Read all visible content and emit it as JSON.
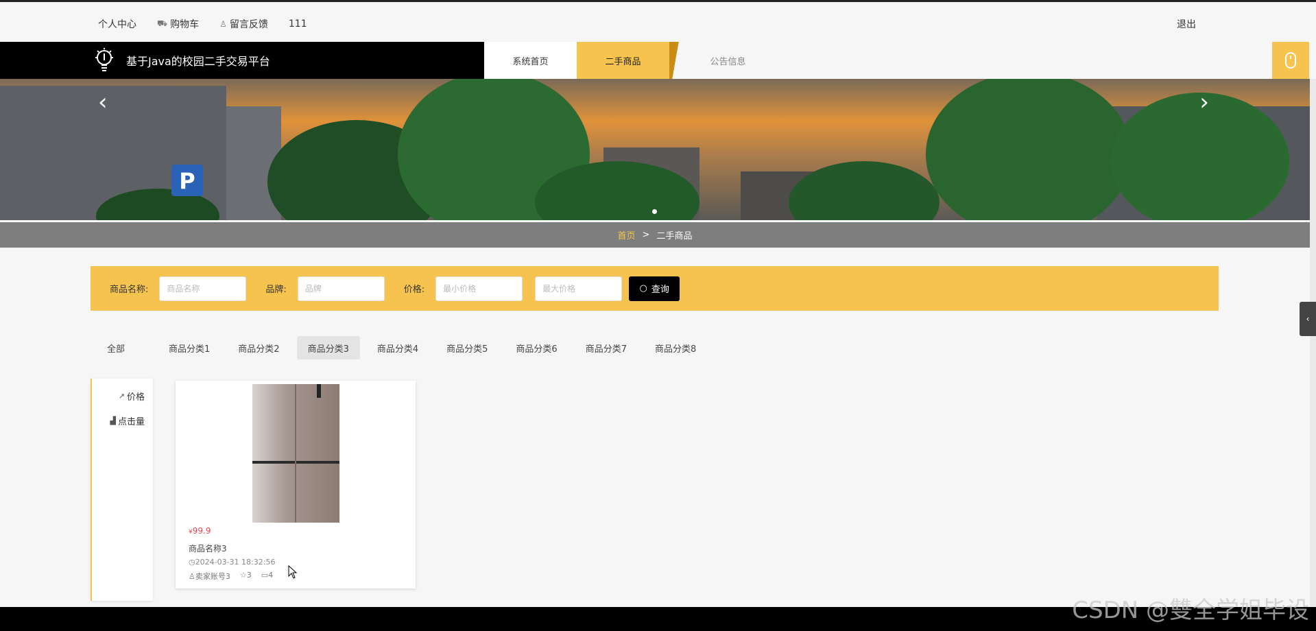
{
  "topbar": {
    "personal_center": "个人中心",
    "cart": "购物车",
    "feedback": "留言反馈",
    "username": "111",
    "logout": "退出"
  },
  "navbar": {
    "site_title": "基于Java的校园二手交易平台",
    "items": [
      {
        "label": "系统首页",
        "active": false
      },
      {
        "label": "二手商品",
        "active": true
      },
      {
        "label": "公告信息",
        "active": false
      }
    ]
  },
  "breadcrumb": {
    "home": "首页",
    "separator": ">",
    "current": "二手商品"
  },
  "search": {
    "name_label": "商品名称:",
    "name_placeholder": "商品名称",
    "brand_label": "品牌:",
    "brand_placeholder": "品牌",
    "price_label": "价格:",
    "min_price_placeholder": "最小价格",
    "max_price_placeholder": "最大价格",
    "button_label": "查询"
  },
  "categories": [
    "全部",
    "商品分类1",
    "商品分类2",
    "商品分类3",
    "商品分类4",
    "商品分类5",
    "商品分类6",
    "商品分类7",
    "商品分类8"
  ],
  "active_category": "商品分类3",
  "sort": {
    "price": "价格",
    "clicks": "点击量"
  },
  "product": {
    "currency": "¥",
    "price": "99.9",
    "name": "商品名称3",
    "time": "2024-03-31 18:32:56",
    "seller": "卖家账号3",
    "favorites": "3",
    "comments": "4"
  },
  "watermark": "CSDN @雙全学姐毕设",
  "colors": {
    "accent": "#f6c44e",
    "price": "#e2464f",
    "brand_bar": "#000000",
    "breadcrumb_bar": "#7e7e7e"
  }
}
